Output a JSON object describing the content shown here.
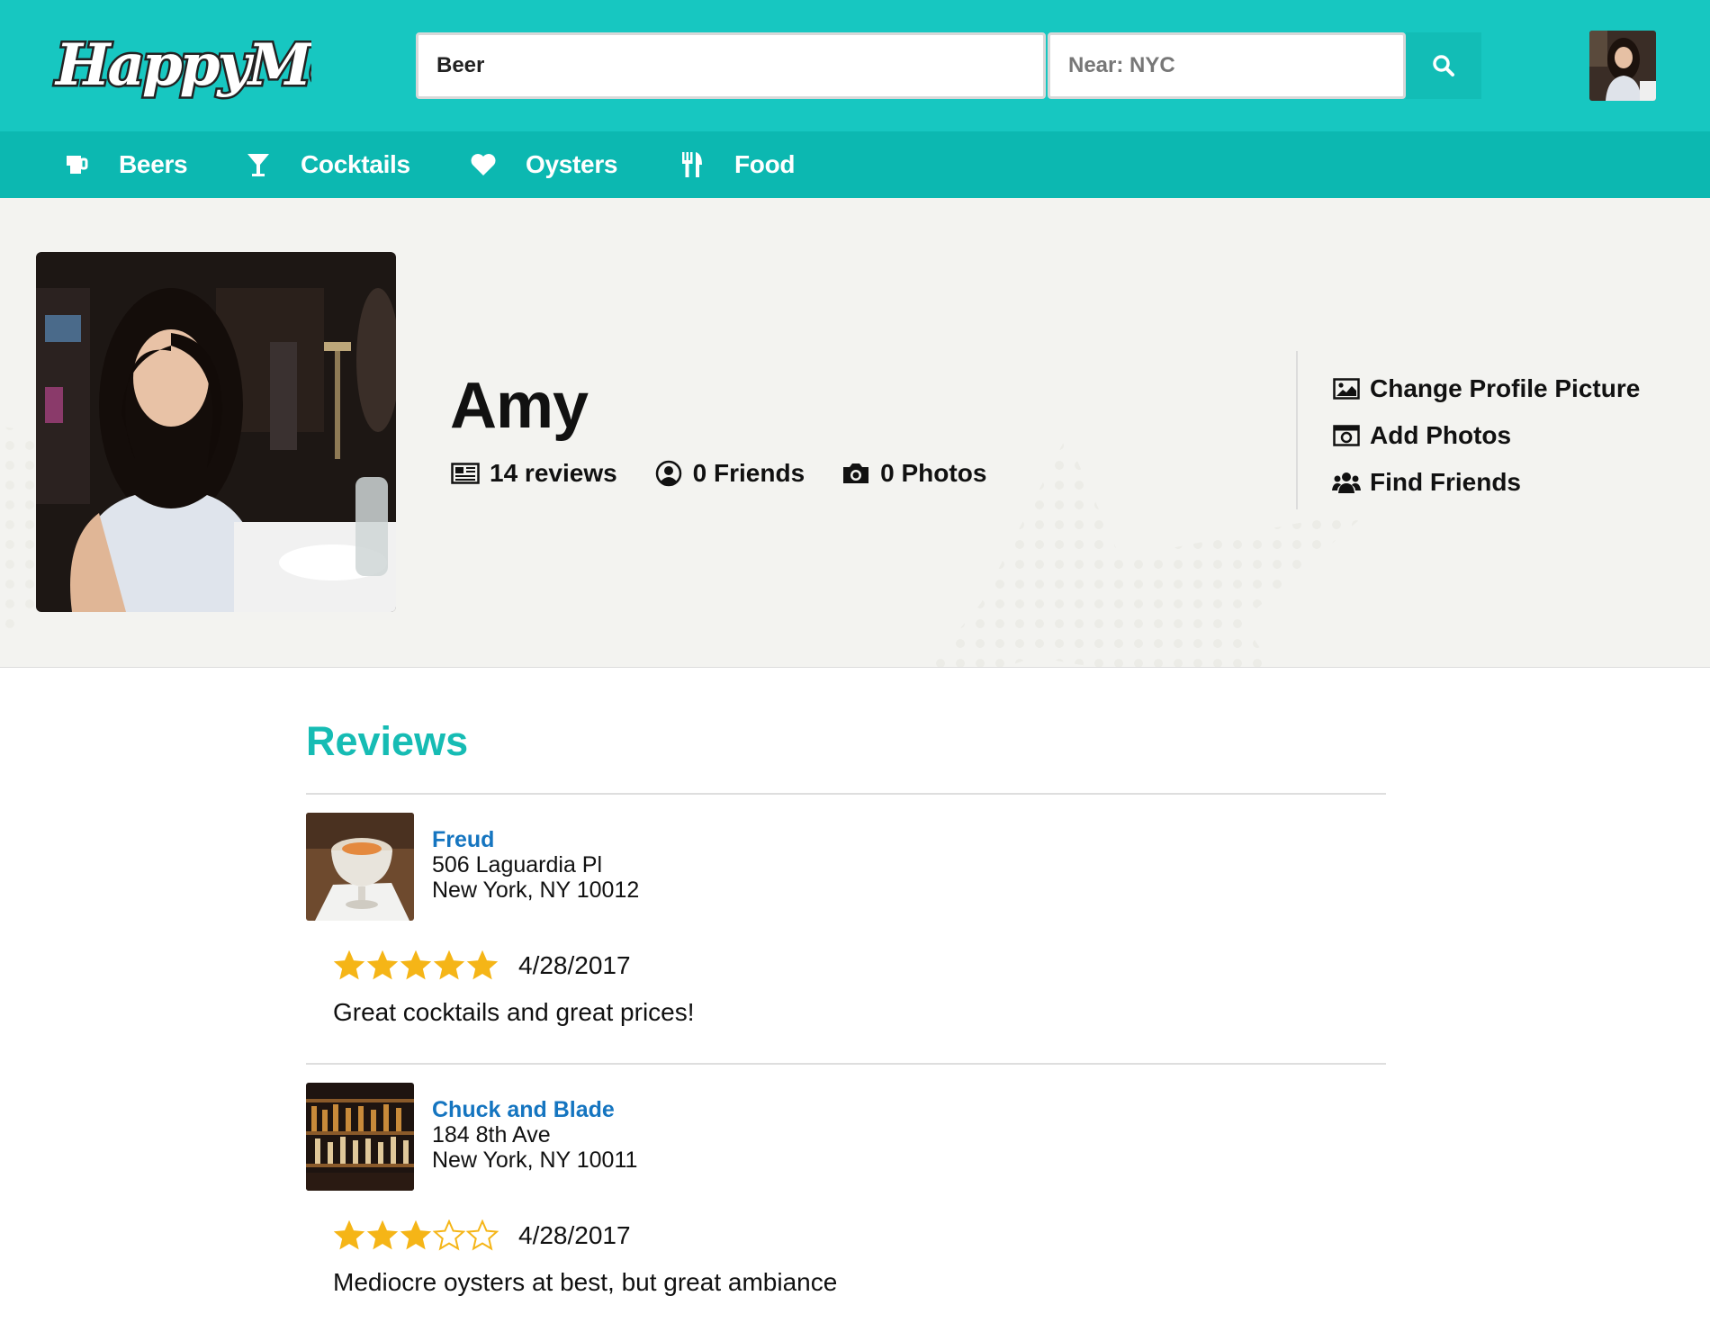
{
  "app": {
    "logo_text": "HappyMe"
  },
  "search": {
    "query_value": "Beer",
    "near_value": "Near: NYC"
  },
  "nav": {
    "items": [
      {
        "label": "Beers",
        "icon": "beer-icon"
      },
      {
        "label": "Cocktails",
        "icon": "cocktail-icon"
      },
      {
        "label": "Oysters",
        "icon": "heart-icon"
      },
      {
        "label": "Food",
        "icon": "utensils-icon"
      }
    ]
  },
  "profile": {
    "name": "Amy",
    "stats": {
      "reviews": "14 reviews",
      "friends": "0 Friends",
      "photos": "0 Photos"
    },
    "actions": {
      "change_picture": "Change Profile Picture",
      "add_photos": "Add Photos",
      "find_friends": "Find Friends"
    }
  },
  "reviews": {
    "title": "Reviews",
    "items": [
      {
        "venue": "Freud",
        "address_line1": "506 Laguardia Pl",
        "address_line2": "New York, NY 10012",
        "rating": 5,
        "max_rating": 5,
        "date": "4/28/2017",
        "text": "Great cocktails and great prices!"
      },
      {
        "venue": "Chuck and Blade",
        "address_line1": "184 8th Ave",
        "address_line2": "New York, NY 10011",
        "rating": 3,
        "max_rating": 5,
        "date": "4/28/2017",
        "text": "Mediocre oysters at best, but great ambiance"
      }
    ]
  },
  "colors": {
    "header_teal": "#17c7c1",
    "nav_teal": "#0cb8b1",
    "reviews_heading": "#16bcb4",
    "venue_link": "#1575c0",
    "star_gold": "#f5b517"
  }
}
